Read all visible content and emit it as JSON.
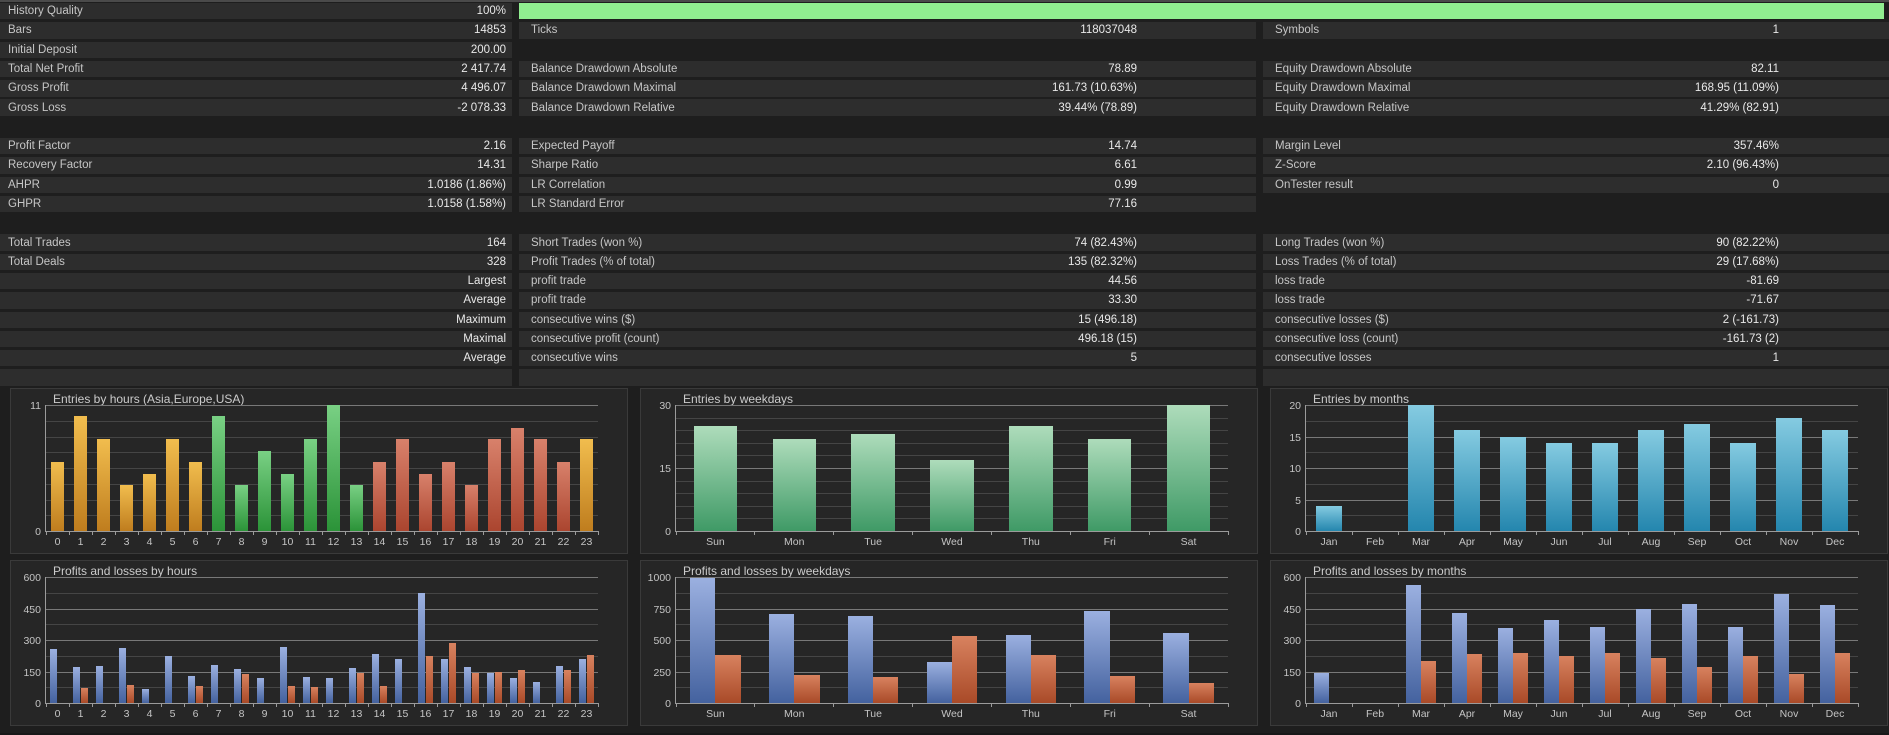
{
  "app": "Strategy Tester Backtest Report",
  "colors": {
    "progress_green": "#90ee90",
    "row_background": "#2d2d2d",
    "page_background": "#1e1e1e",
    "profit_blue": "#5f7fc0",
    "loss_red": "#bb5a3c"
  },
  "stats": {
    "rows": [
      {
        "c1": {
          "label": "History Quality",
          "value": "100%"
        },
        "progress": true
      },
      {
        "c1": {
          "label": "Bars",
          "value": "14853"
        },
        "c2": {
          "label": "Ticks",
          "value": "118037048"
        },
        "c3": {
          "label": "Symbols",
          "value": "1"
        }
      },
      {
        "c1": {
          "label": "Initial Deposit",
          "value": "200.00"
        }
      },
      {
        "c1": {
          "label": "Total Net Profit",
          "value": "2 417.74"
        },
        "c2": {
          "label": "Balance Drawdown Absolute",
          "value": "78.89"
        },
        "c3": {
          "label": "Equity Drawdown Absolute",
          "value": "82.11"
        }
      },
      {
        "c1": {
          "label": "Gross Profit",
          "value": "4 496.07"
        },
        "c2": {
          "label": "Balance Drawdown Maximal",
          "value": "161.73 (10.63%)"
        },
        "c3": {
          "label": "Equity Drawdown Maximal",
          "value": "168.95 (11.09%)"
        }
      },
      {
        "c1": {
          "label": "Gross Loss",
          "value": "-2 078.33"
        },
        "c2": {
          "label": "Balance Drawdown Relative",
          "value": "39.44% (78.89)"
        },
        "c3": {
          "label": "Equity Drawdown Relative",
          "value": "41.29% (82.91)"
        }
      },
      {
        "blank": true
      },
      {
        "c1": {
          "label": "Profit Factor",
          "value": "2.16"
        },
        "c2": {
          "label": "Expected Payoff",
          "value": "14.74"
        },
        "c3": {
          "label": "Margin Level",
          "value": "357.46%"
        }
      },
      {
        "c1": {
          "label": "Recovery Factor",
          "value": "14.31"
        },
        "c2": {
          "label": "Sharpe Ratio",
          "value": "6.61"
        },
        "c3": {
          "label": "Z-Score",
          "value": "2.10 (96.43%)"
        }
      },
      {
        "c1": {
          "label": "AHPR",
          "value": "1.0186 (1.86%)"
        },
        "c2": {
          "label": "LR Correlation",
          "value": "0.99"
        },
        "c3": {
          "label": "OnTester result",
          "value": "0"
        }
      },
      {
        "c1": {
          "label": "GHPR",
          "value": "1.0158 (1.58%)"
        },
        "c2": {
          "label": "LR Standard Error",
          "value": "77.16"
        }
      },
      {
        "blank": true
      },
      {
        "c1": {
          "label": "Total Trades",
          "value": "164"
        },
        "c2": {
          "label": "Short Trades (won %)",
          "value": "74 (82.43%)"
        },
        "c3": {
          "label": "Long Trades (won %)",
          "value": "90 (82.22%)"
        }
      },
      {
        "c1": {
          "label": "Total Deals",
          "value": "328"
        },
        "c2": {
          "label": "Profit Trades (% of total)",
          "value": "135 (82.32%)"
        },
        "c3": {
          "label": "Loss Trades (% of total)",
          "value": "29 (17.68%)"
        }
      },
      {
        "c1": {
          "label": "",
          "value": "Largest"
        },
        "c2": {
          "label": "profit trade",
          "value": "44.56"
        },
        "c3": {
          "label": "loss trade",
          "value": "-81.69"
        }
      },
      {
        "c1": {
          "label": "",
          "value": "Average"
        },
        "c2": {
          "label": "profit trade",
          "value": "33.30"
        },
        "c3": {
          "label": "loss trade",
          "value": "-71.67"
        }
      },
      {
        "c1": {
          "label": "",
          "value": "Maximum"
        },
        "c2": {
          "label": "consecutive wins ($)",
          "value": "15 (496.18)"
        },
        "c3": {
          "label": "consecutive losses ($)",
          "value": "2 (-161.73)"
        }
      },
      {
        "c1": {
          "label": "",
          "value": "Maximal"
        },
        "c2": {
          "label": "consecutive profit (count)",
          "value": "496.18 (15)"
        },
        "c3": {
          "label": "consecutive loss (count)",
          "value": "-161.73 (2)"
        }
      },
      {
        "c1": {
          "label": "",
          "value": "Average"
        },
        "c2": {
          "label": "consecutive wins",
          "value": "5"
        },
        "c3": {
          "label": "consecutive losses",
          "value": "1"
        }
      },
      {
        "c1": {
          "label": "",
          "value": ""
        },
        "c2": {
          "label": "",
          "value": ""
        },
        "c3": {
          "label": "",
          "value": ""
        }
      }
    ]
  },
  "chart_data": [
    {
      "id": "entries-by-hours",
      "type": "bar",
      "title": "Entries by hours (Asia,Europe,USA)",
      "categories": [
        "0",
        "1",
        "2",
        "3",
        "4",
        "5",
        "6",
        "7",
        "8",
        "9",
        "10",
        "11",
        "12",
        "13",
        "14",
        "15",
        "16",
        "17",
        "18",
        "19",
        "20",
        "21",
        "22",
        "23"
      ],
      "values": [
        6,
        10,
        8,
        4,
        5,
        8,
        6,
        10,
        4,
        7,
        5,
        8,
        11,
        4,
        6,
        8,
        5,
        6,
        4,
        8,
        9,
        8,
        6,
        8
      ],
      "groups": [
        "asia",
        "asia",
        "asia",
        "asia",
        "asia",
        "asia",
        "asia",
        "europe",
        "europe",
        "europe",
        "europe",
        "europe",
        "europe",
        "europe",
        "usa",
        "usa",
        "usa",
        "usa",
        "usa",
        "usa",
        "usa",
        "usa",
        "usa",
        "asia"
      ],
      "palette": {
        "asia": [
          "#f1bd4e",
          "#bf7d1e"
        ],
        "europe": [
          "#79d084",
          "#2b9338"
        ],
        "usa": [
          "#d8816b",
          "#ab452f"
        ]
      },
      "ylim": [
        0,
        11
      ],
      "yticks": [
        0,
        11
      ],
      "grid_divisions": 8,
      "legend": "none",
      "grid": true
    },
    {
      "id": "entries-by-weekdays",
      "type": "bar",
      "title": "Entries by weekdays",
      "categories": [
        "Sun",
        "Mon",
        "Tue",
        "Wed",
        "Thu",
        "Fri",
        "Sat"
      ],
      "values": [
        25,
        22,
        23,
        17,
        25,
        22,
        30
      ],
      "groups": [
        "bar",
        "bar",
        "bar",
        "bar",
        "bar",
        "bar",
        "bar"
      ],
      "palette": {
        "bar": [
          "#aedcbb",
          "#3f9a66"
        ]
      },
      "ylim": [
        0,
        30
      ],
      "yticks": [
        0,
        15,
        30
      ],
      "grid_divisions": 10,
      "legend": "none",
      "grid": true
    },
    {
      "id": "entries-by-months",
      "type": "bar",
      "title": "Entries by months",
      "categories": [
        "Jan",
        "Feb",
        "Mar",
        "Apr",
        "May",
        "Jun",
        "Jul",
        "Aug",
        "Sep",
        "Oct",
        "Nov",
        "Dec"
      ],
      "values": [
        4,
        0,
        20,
        16,
        15,
        14,
        14,
        16,
        17,
        14,
        18,
        16
      ],
      "groups": [
        "bar",
        "bar",
        "bar",
        "bar",
        "bar",
        "bar",
        "bar",
        "bar",
        "bar",
        "bar",
        "bar",
        "bar"
      ],
      "palette": {
        "bar": [
          "#85cbe1",
          "#2486ae"
        ]
      },
      "ylim": [
        0,
        20
      ],
      "yticks": [
        0,
        5,
        10,
        15,
        20
      ],
      "grid_divisions": 8,
      "legend": "none",
      "grid": true
    },
    {
      "id": "profits-losses-by-hours",
      "type": "bar",
      "title": "Profits and losses by hours",
      "categories": [
        "0",
        "1",
        "2",
        "3",
        "4",
        "5",
        "6",
        "7",
        "8",
        "9",
        "10",
        "11",
        "12",
        "13",
        "14",
        "15",
        "16",
        "17",
        "18",
        "19",
        "20",
        "21",
        "22",
        "23"
      ],
      "series": [
        {
          "name": "profit",
          "values": [
            255,
            172,
            177,
            263,
            65,
            222,
            130,
            180,
            164,
            120,
            268,
            126,
            120,
            167,
            233,
            210,
            525,
            210,
            170,
            143,
            120,
            100,
            177,
            211
          ]
        },
        {
          "name": "loss",
          "values": [
            0,
            70,
            0,
            84,
            0,
            0,
            81,
            0,
            138,
            0,
            80,
            78,
            0,
            144,
            80,
            0,
            226,
            288,
            141,
            148,
            155,
            0,
            157,
            231
          ]
        }
      ],
      "palette": {
        "profit": [
          "#9bb0e0",
          "#44629f"
        ],
        "loss": [
          "#d8825f",
          "#a94a28"
        ]
      },
      "ylim": [
        0,
        600
      ],
      "yticks": [
        0,
        150,
        300,
        450,
        600
      ],
      "grid_divisions": 8,
      "legend": "none",
      "grid": true
    },
    {
      "id": "profits-losses-by-weekdays",
      "type": "bar",
      "title": "Profits and losses by weekdays",
      "categories": [
        "Sun",
        "Mon",
        "Tue",
        "Wed",
        "Thu",
        "Fri",
        "Sat"
      ],
      "series": [
        {
          "name": "profit",
          "values": [
            990,
            707,
            690,
            327,
            542,
            728,
            555
          ]
        },
        {
          "name": "loss",
          "values": [
            385,
            220,
            207,
            534,
            385,
            212,
            162
          ]
        }
      ],
      "palette": {
        "profit": [
          "#9bb0e0",
          "#44629f"
        ],
        "loss": [
          "#d8825f",
          "#a94a28"
        ]
      },
      "ylim": [
        0,
        1000
      ],
      "yticks": [
        0,
        250,
        500,
        750,
        1000
      ],
      "grid_divisions": 8,
      "legend": "none",
      "grid": true
    },
    {
      "id": "profits-losses-by-months",
      "type": "bar",
      "title": "Profits and losses by months",
      "categories": [
        "Jan",
        "Feb",
        "Mar",
        "Apr",
        "May",
        "Jun",
        "Jul",
        "Aug",
        "Sep",
        "Oct",
        "Nov",
        "Dec"
      ],
      "series": [
        {
          "name": "profit",
          "values": [
            144,
            0,
            562,
            430,
            357,
            393,
            361,
            446,
            471,
            361,
            521,
            465
          ]
        },
        {
          "name": "loss",
          "values": [
            0,
            0,
            201,
            232,
            239,
            223,
            239,
            215,
            171,
            223,
            138,
            236
          ]
        }
      ],
      "palette": {
        "profit": [
          "#9bb0e0",
          "#44629f"
        ],
        "loss": [
          "#d8825f",
          "#a94a28"
        ]
      },
      "ylim": [
        0,
        600
      ],
      "yticks": [
        0,
        150,
        300,
        450,
        600
      ],
      "grid_divisions": 8,
      "legend": "none",
      "grid": true
    }
  ]
}
